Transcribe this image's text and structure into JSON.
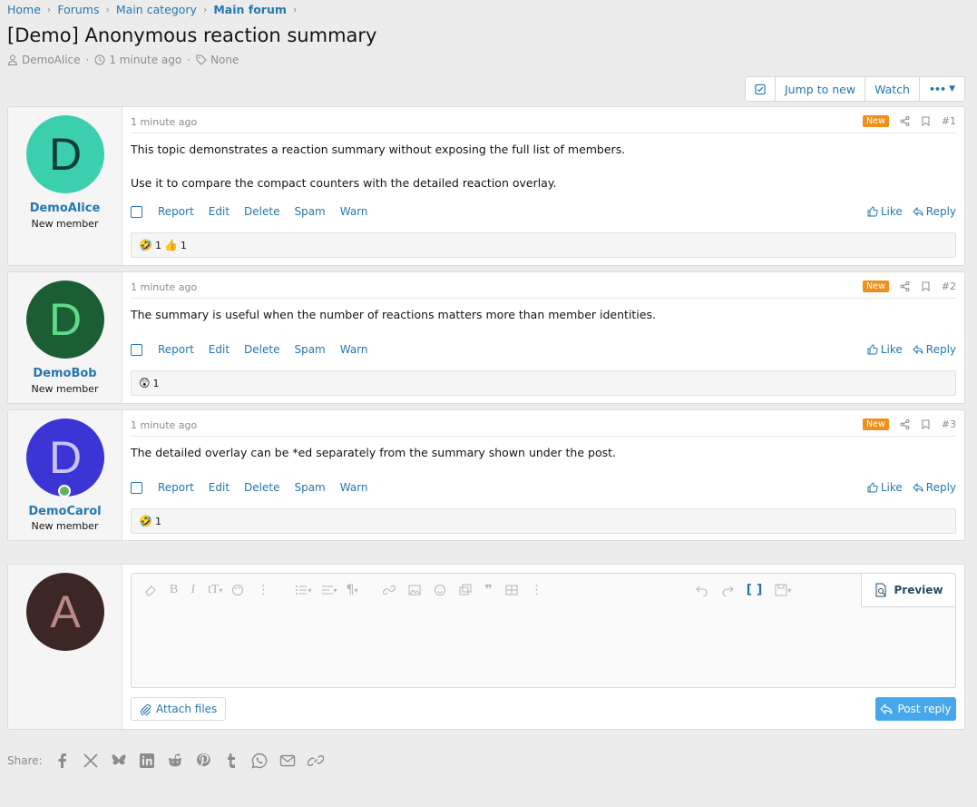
{
  "breadcrumb": {
    "home": "Home",
    "forums": "Forums",
    "category": "Main category",
    "forum": "Main forum"
  },
  "thread": {
    "title": "[Demo] Anonymous reaction summary",
    "author": "DemoAlice",
    "time": "1 minute ago",
    "tags": "None"
  },
  "toolbar": {
    "jump": "Jump to new",
    "watch": "Watch",
    "more": "•••"
  },
  "actions": {
    "report": "Report",
    "edit": "Edit",
    "delete": "Delete",
    "spam": "Spam",
    "warn": "Warn",
    "like": "Like",
    "reply": "Reply"
  },
  "badge_new": "New",
  "posts": [
    {
      "username": "DemoAlice",
      "usertitle": "New member",
      "initial": "D",
      "avatar_bg": "#3ccfae",
      "avatar_fg": "#0e3d33",
      "time": "1 minute ago",
      "num": "#1",
      "p1": "This topic demonstrates a reaction summary without exposing the full list of members.",
      "p2": "Use it to compare the compact counters with the detailed reaction overlay.",
      "reactions": [
        {
          "emoji": "🤣",
          "count": "1"
        },
        {
          "emoji": "👍",
          "count": "1"
        }
      ]
    },
    {
      "username": "DemoBob",
      "usertitle": "New member",
      "initial": "D",
      "avatar_bg": "#1b5e34",
      "avatar_fg": "#5fd98a",
      "time": "1 minute ago",
      "num": "#2",
      "p1": "The summary is useful when the number of reactions matters more than member identities.",
      "reactions": [
        {
          "emoji": "😲",
          "count": "1"
        }
      ]
    },
    {
      "username": "DemoCarol",
      "usertitle": "New member",
      "initial": "D",
      "avatar_bg": "#3b35d6",
      "avatar_fg": "#c9c4f5",
      "time": "1 minute ago",
      "num": "#3",
      "p1": "The detailed overlay can be *ed separately from the summary shown under the post.",
      "reactions": [
        {
          "emoji": "🤣",
          "count": "1"
        }
      ]
    }
  ],
  "reply_box": {
    "initial": "A",
    "avatar_bg": "#3d2626",
    "avatar_fg": "#b98a85",
    "preview": "Preview",
    "attach": "Attach files",
    "post_reply": "Post reply"
  },
  "share": {
    "label": "Share:",
    "icons": [
      "facebook-icon",
      "x-icon",
      "bluesky-icon",
      "linkedin-icon",
      "reddit-icon",
      "pinterest-icon",
      "tumblr-icon",
      "whatsapp-icon",
      "email-icon",
      "link-icon"
    ]
  },
  "colors": {
    "link": "#2577b1",
    "new_badge": "#f0901b",
    "post_reply_button": "#47a7eb"
  }
}
